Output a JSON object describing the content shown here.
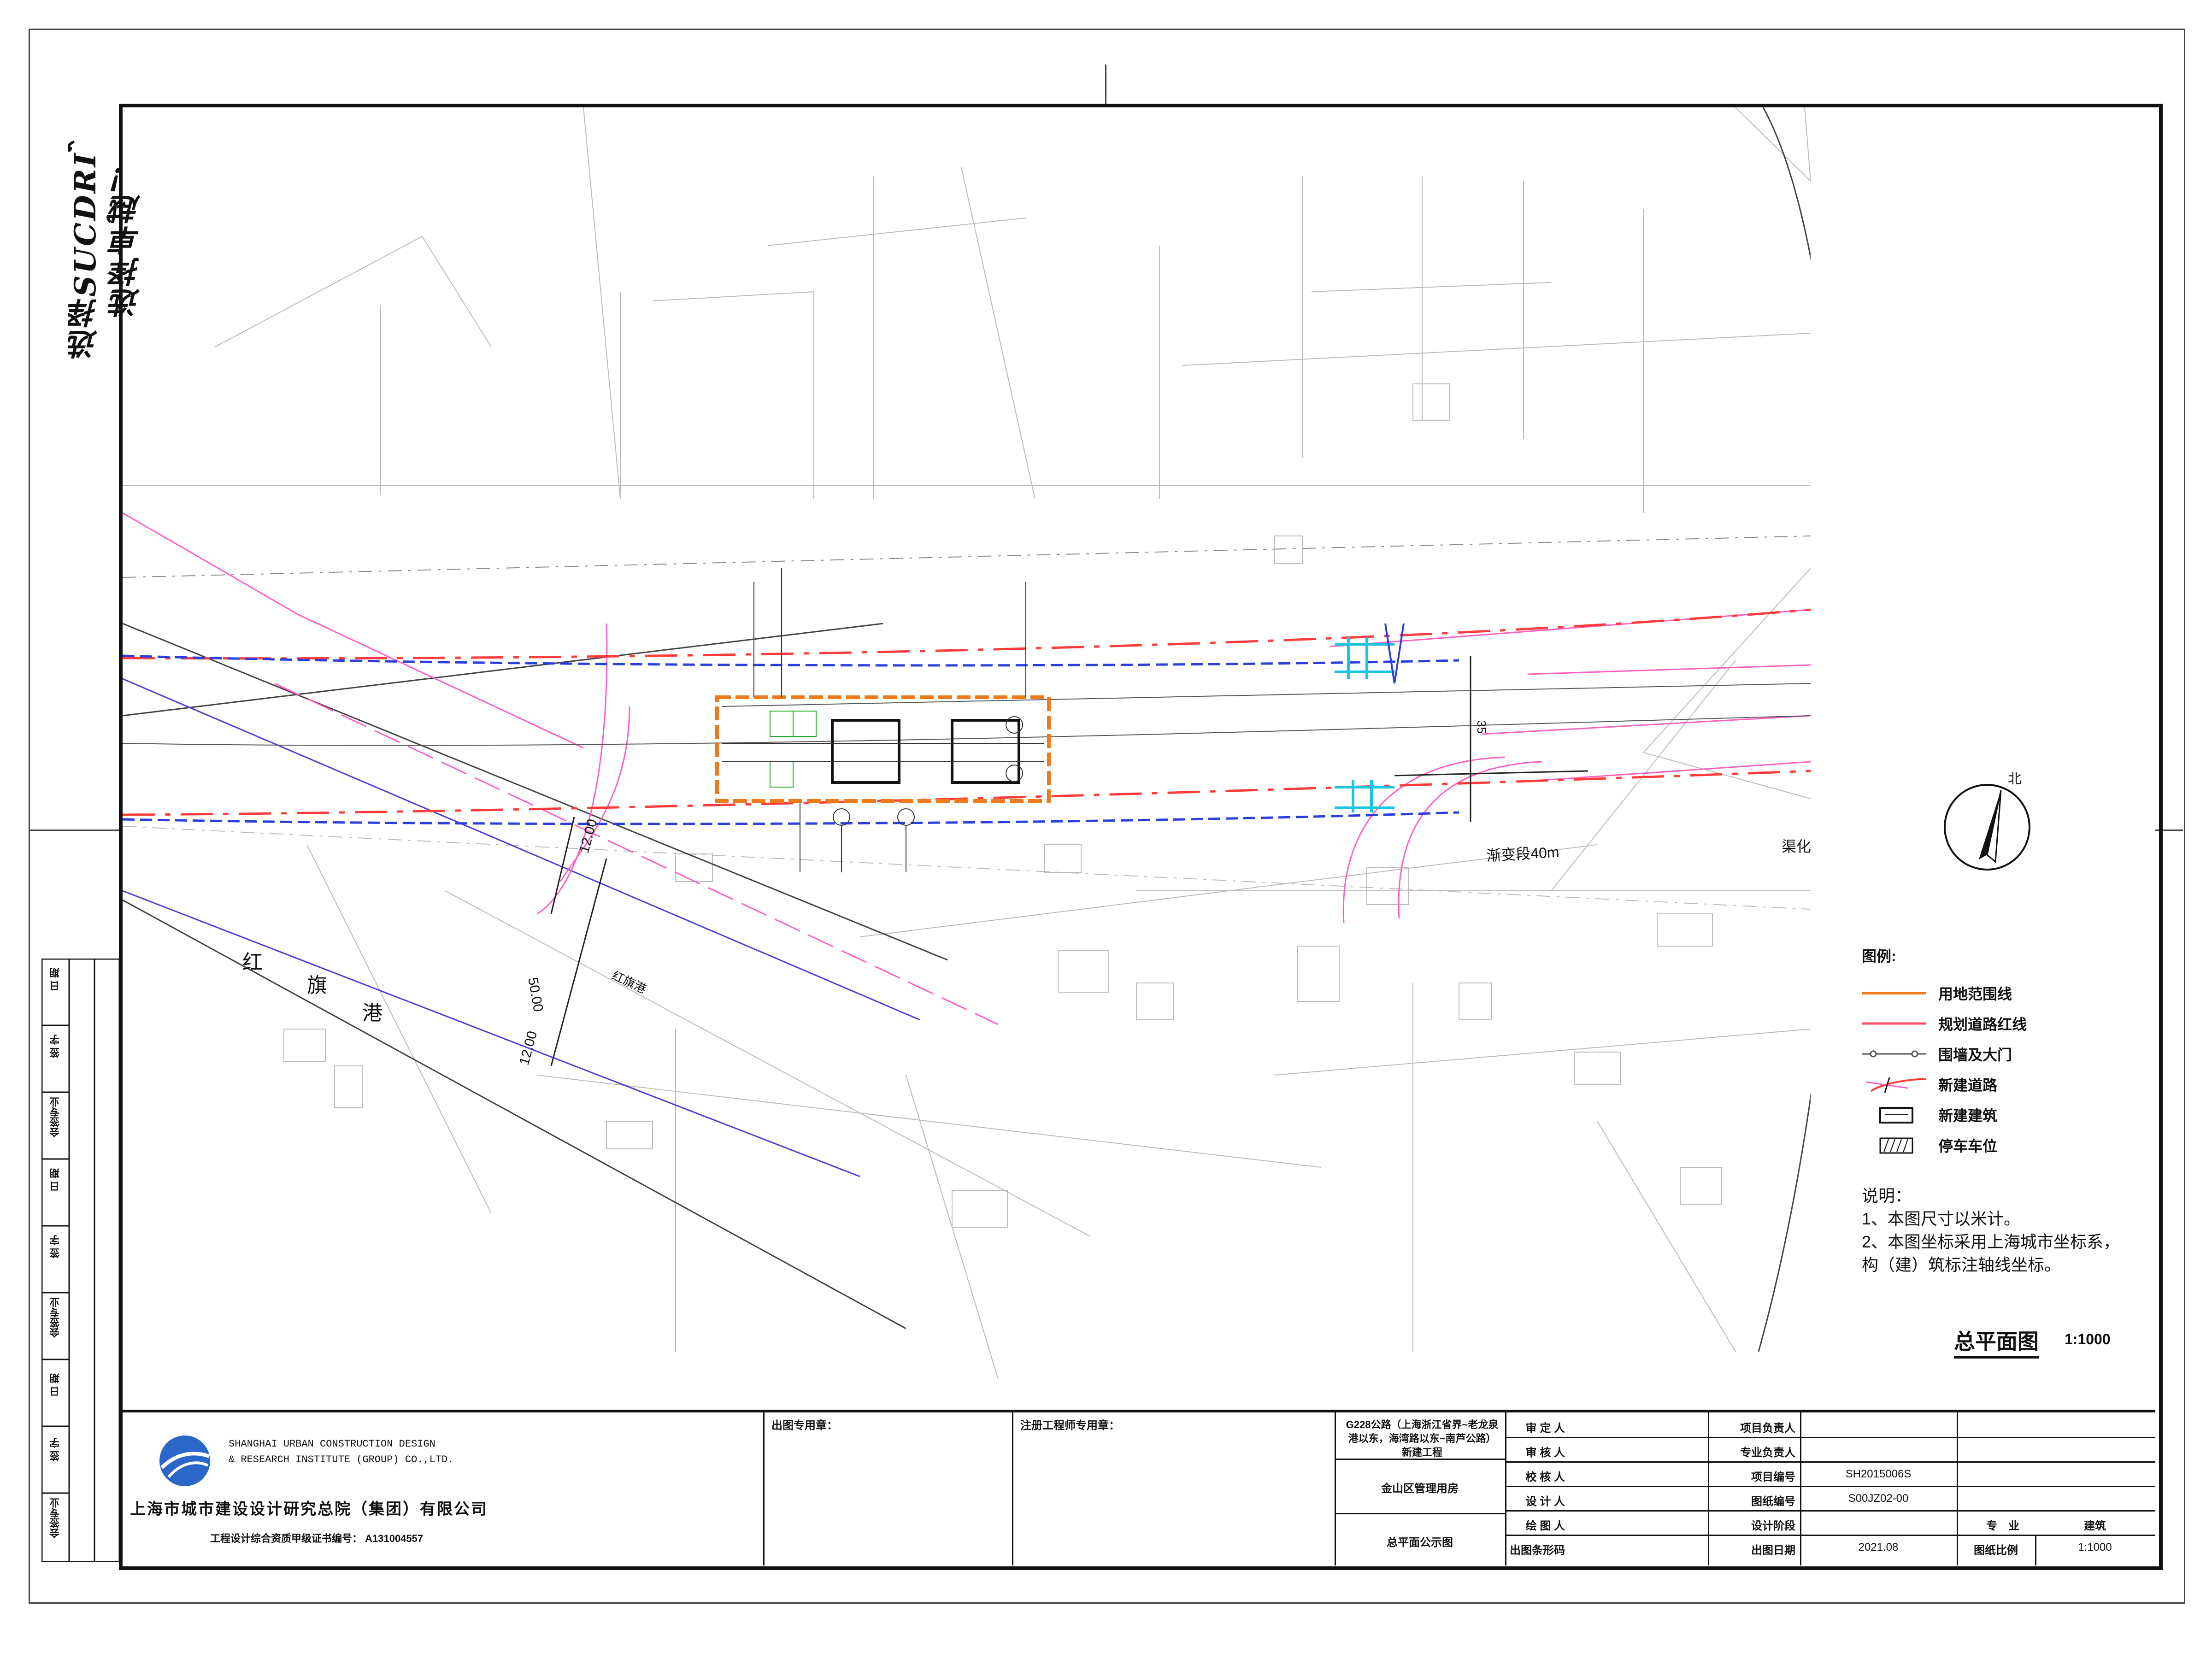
{
  "slogan": "选择SUCDRI，选择卓越！",
  "map": {
    "labels": {
      "river_left_1": "红",
      "river_left_2": "旗",
      "river_left_3": "港",
      "dim_width": "50.00",
      "dim_side1": "12.00",
      "dim_side2": "12.00",
      "taper": "渐变段40m",
      "taper2": "渠化",
      "road_dim": "35",
      "river_road": "红旗港"
    }
  },
  "north": "北",
  "legend": {
    "title": "图例:",
    "items": [
      {
        "label": "用地范围线",
        "color": "#f07a1a"
      },
      {
        "label": "规划道路红线",
        "color": "#ff4d6a"
      },
      {
        "label": "围墙及大门",
        "color": "#555555"
      },
      {
        "label": "新建道路",
        "color": "#ff3b3b"
      },
      {
        "label": "新建建筑",
        "color": "#111111"
      },
      {
        "label": "停车车位",
        "color": "#111111"
      }
    ]
  },
  "notes": {
    "title": "说明：",
    "line1": "1、本图尺寸以米计。",
    "line2": "2、本图坐标采用上海城市坐标系，",
    "line3": "构（建）筑标注轴线坐标。"
  },
  "plan": {
    "title": "总平面图",
    "scale": "1:1000"
  },
  "title_block": {
    "company_en_1": "SHANGHAI URBAN CONSTRUCTION DESIGN",
    "company_en_2": "& RESEARCH INSTITUTE (GROUP) CO.,LTD.",
    "company_cn": "上海市城市建设设计研究总院（集团）有限公司",
    "license": "工程设计综合资质甲级证书编号： A131004557",
    "seal_label": "出图专用章：",
    "engineer_label": "注册工程师专用章：",
    "project_name": "G228公路（上海浙江省界~老龙泉港以东，海湾路以东~南芦公路）新建工程",
    "sub_project": "金山区管理用房",
    "drawing_name": "总平面公示图",
    "roles": [
      "审 定 人",
      "审 核 人",
      "校 核 人",
      "设 计 人",
      "绘 图 人",
      "出图条形码"
    ],
    "right_labels": [
      "项目负责人",
      "专业负责人",
      "项目编号",
      "图纸编号",
      "设计阶段",
      "出图日期"
    ],
    "project_no": "SH2015006S",
    "drawing_no": "S00JZ02-00",
    "discipline_label": "专　业",
    "discipline": "建筑",
    "date": "2021.08",
    "scale_label": "图纸比例",
    "scale": "1:1000",
    "sign_cols": [
      "会签专业",
      "签 字",
      "日 期",
      "会签专业",
      "签 字",
      "日 期",
      "会签专业",
      "签 字",
      "日 期"
    ]
  }
}
